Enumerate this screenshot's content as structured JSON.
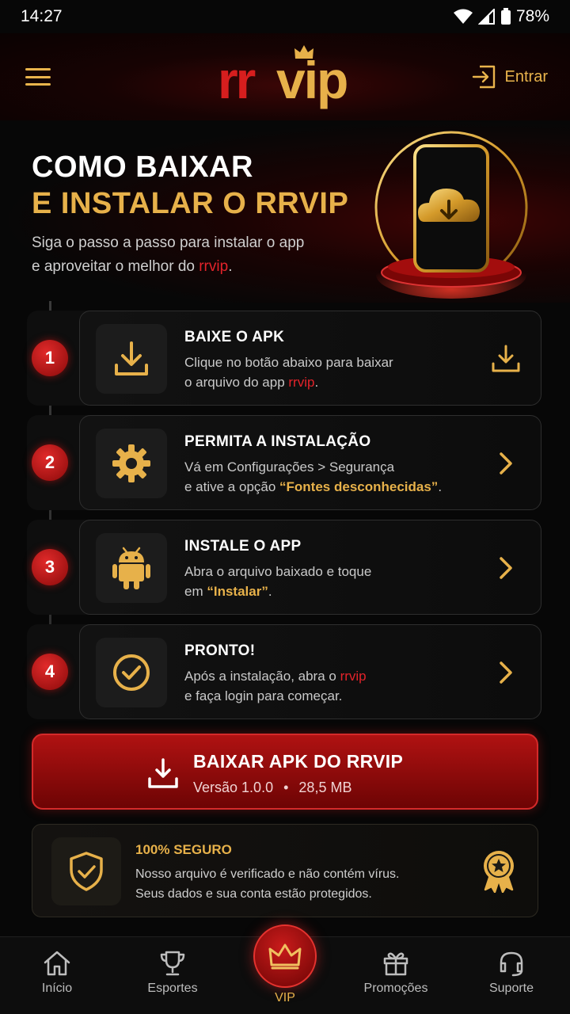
{
  "status": {
    "time": "14:27",
    "battery": "78%"
  },
  "header": {
    "logo_left": "rr",
    "logo_right": "vip",
    "login_label": "Entrar"
  },
  "hero": {
    "title_line1": "COMO BAIXAR",
    "title_line2": "E INSTALAR O RRVIP",
    "subtitle_a": "Siga o passo a passo para instalar o app",
    "subtitle_b": "e aproveitar o melhor do ",
    "subtitle_brand": "rrvip",
    "subtitle_end": "."
  },
  "steps": [
    {
      "num": "1",
      "title": "BAIXE O APK",
      "icon": "download-icon",
      "action_icon": "download-icon",
      "desc_a": "Clique no botão abaixo para baixar",
      "desc_b": "o arquivo do app ",
      "desc_hl": "rrvip",
      "desc_end": "."
    },
    {
      "num": "2",
      "title": "PERMITA A INSTALAÇÃO",
      "icon": "gear-icon",
      "action_icon": "chevron-right-icon",
      "desc_a": "Vá em Configurações > Segurança",
      "desc_b": "e ative a opção ",
      "desc_hl": "“Fontes desconhecidas”",
      "desc_end": "."
    },
    {
      "num": "3",
      "title": "INSTALE O APP",
      "icon": "android-icon",
      "action_icon": "chevron-right-icon",
      "desc_a": "Abra o arquivo baixado e toque",
      "desc_b": "em ",
      "desc_hl": "“Instalar”",
      "desc_end": "."
    },
    {
      "num": "4",
      "title": "PRONTO!",
      "icon": "check-circle-icon",
      "action_icon": "chevron-right-icon",
      "desc_a": "Após a instalação, abra o ",
      "desc_a_hl": "rrvip",
      "desc_b": "e faça login para começar."
    }
  ],
  "download": {
    "title": "BAIXAR APK DO RRVIP",
    "version": "Versão 1.0.0",
    "separator": "•",
    "size": "28,5 MB"
  },
  "secure": {
    "title": "100% SEGURO",
    "line1": "Nosso arquivo é verificado e não contém vírus.",
    "line2": "Seus dados e sua conta estão protegidos."
  },
  "nav": [
    {
      "label": "Início",
      "icon": "home-icon"
    },
    {
      "label": "Esportes",
      "icon": "trophy-icon"
    },
    {
      "label": "VIP",
      "icon": "crown-icon"
    },
    {
      "label": "Promoções",
      "icon": "gift-icon"
    },
    {
      "label": "Suporte",
      "icon": "headset-icon"
    }
  ],
  "colors": {
    "gold": "#e7b14a",
    "red": "#d61e1e",
    "background": "#070707"
  }
}
